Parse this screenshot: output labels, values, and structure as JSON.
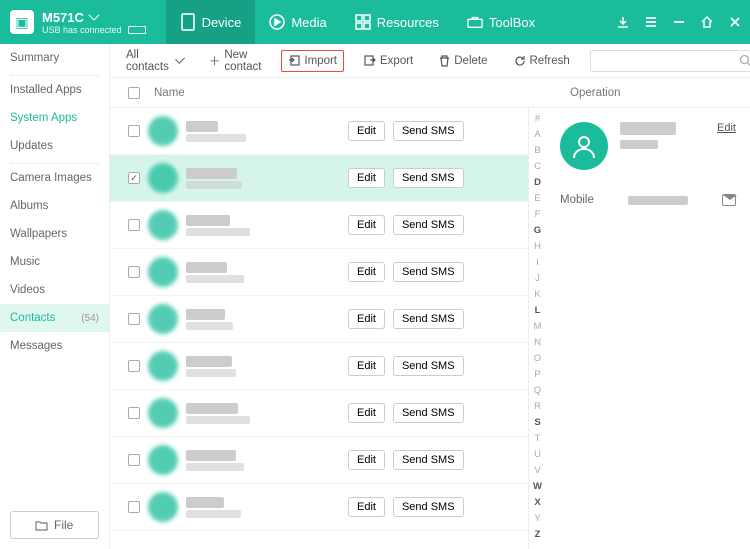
{
  "device": {
    "name": "M571C",
    "status": "USB has connected"
  },
  "nav": {
    "device": "Device",
    "media": "Media",
    "resources": "Resources",
    "toolbox": "ToolBox"
  },
  "sidebar": {
    "items": [
      "Summary",
      "Installed Apps",
      "System Apps",
      "Updates",
      "Camera Images",
      "Albums",
      "Wallpapers",
      "Music",
      "Videos",
      "Contacts",
      "Messages"
    ],
    "contacts_count": "(54)"
  },
  "file_btn": "File",
  "toolbar": {
    "filter": "All contacts",
    "new": "New contact",
    "import": "Import",
    "export": "Export",
    "delete": "Delete",
    "refresh": "Refresh"
  },
  "columns": {
    "name": "Name",
    "operation": "Operation"
  },
  "row_btn": {
    "edit": "Edit",
    "sms": "Send SMS"
  },
  "rows_count": 9,
  "selected_row": 1,
  "index_letters": [
    "#",
    "A",
    "B",
    "C",
    "D",
    "E",
    "F",
    "G",
    "H",
    "I",
    "J",
    "K",
    "L",
    "M",
    "N",
    "O",
    "P",
    "Q",
    "R",
    "S",
    "T",
    "U",
    "V",
    "W",
    "X",
    "Y",
    "Z"
  ],
  "index_active": [
    "D",
    "G",
    "L",
    "S",
    "W",
    "X",
    "Z"
  ],
  "details": {
    "edit": "Edit",
    "mobile_label": "Mobile"
  }
}
